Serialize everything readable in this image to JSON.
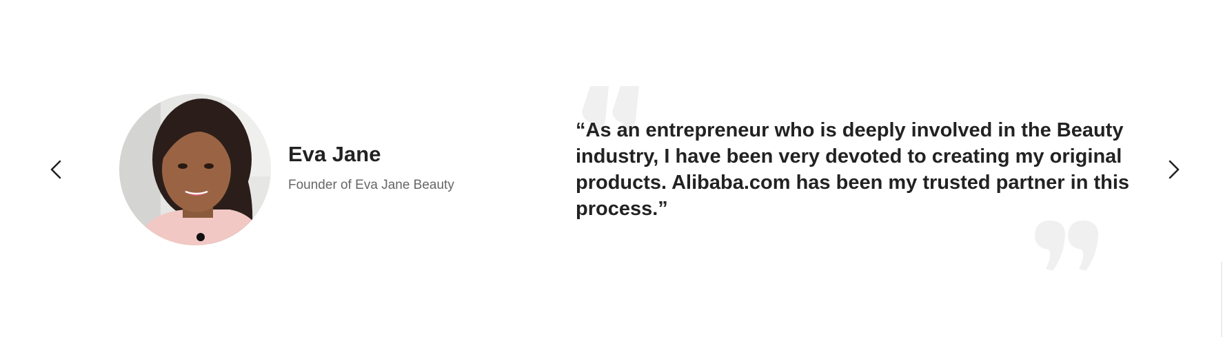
{
  "testimonial": {
    "name": "Eva Jane",
    "role": "Founder of Eva Jane Beauty",
    "quote": "“As an entrepreneur who is deeply involved in the Beauty industry, I have been very devoted to creating my original products. Alibaba.com has been my trusted partner in this process.”",
    "avatar_icon": "person-photo",
    "quote_open_icon": "open-quote-icon",
    "quote_close_icon": "close-quote-icon"
  },
  "navigation": {
    "prev_icon": "chevron-left-icon",
    "next_icon": "chevron-right-icon"
  },
  "colors": {
    "text": "#222222",
    "muted": "#666666",
    "quote_mark": "#f0f0f0"
  }
}
